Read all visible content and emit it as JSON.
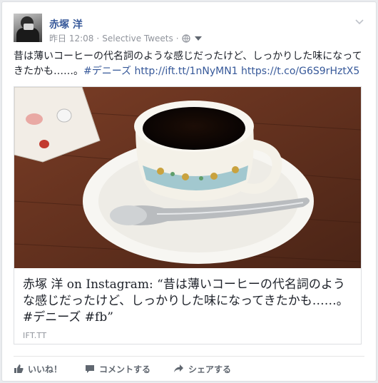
{
  "post": {
    "author": "赤塚 洋",
    "timestamp": "昨日 12:08",
    "separator": "·",
    "via": "Selective Tweets",
    "separator2": "·",
    "privacy_icon": "globe-icon",
    "options_icon": "chevron-down-icon",
    "text_body": "昔は薄いコーヒーの代名詞のような感じだったけど、しっかりした味になってきたかも……。",
    "hashtag": "#デニーズ",
    "link1": "http://ift.tt/1nNyMN1",
    "link2": "https://t.co/G6S9rHztX5"
  },
  "link_preview": {
    "title": "赤塚 洋 on Instagram: “昔は薄いコーヒーの代名詞のような感じだったけど、しっかりした味になってきたかも……。#デニーズ #fb”",
    "domain": "IFT.TT"
  },
  "actions": {
    "like": "いいね！",
    "comment": "コメントする",
    "share": "シェアする"
  },
  "colors": {
    "link": "#365899",
    "meta": "#90949c",
    "action": "#606770"
  }
}
